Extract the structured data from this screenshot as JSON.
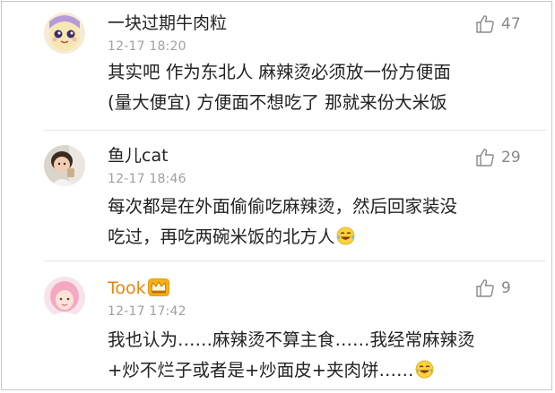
{
  "comments": [
    {
      "username": "一块过期牛肉粒",
      "time": "12-17 18:20",
      "likes": "47",
      "lines": [
        "其实吧 作为东北人 麻辣烫必须放一份方便面",
        "(量大便宜) 方便面不想吃了 那就来份大米饭"
      ]
    },
    {
      "username": "鱼儿cat",
      "time": "12-17 18:46",
      "likes": "29",
      "lines": [
        "每次都是在外面偷偷吃麻辣烫，然后回家装没",
        "吃过，再吃两碗米饭的北方人"
      ]
    },
    {
      "username": "Took",
      "time": "12-17 17:42",
      "likes": "9",
      "lines": [
        "我也认为……麻辣烫不算主食……我经常麻辣烫",
        "+炒不烂子或者是+炒面皮+夹肉饼……"
      ]
    }
  ],
  "colors": {
    "vip_name": "#e8860f",
    "timestamp": "#a0a0a0",
    "like_icon": "#888888"
  },
  "icons": [
    "thumbs-up-icon",
    "laughing-emoji-icon",
    "crown-icon"
  ]
}
